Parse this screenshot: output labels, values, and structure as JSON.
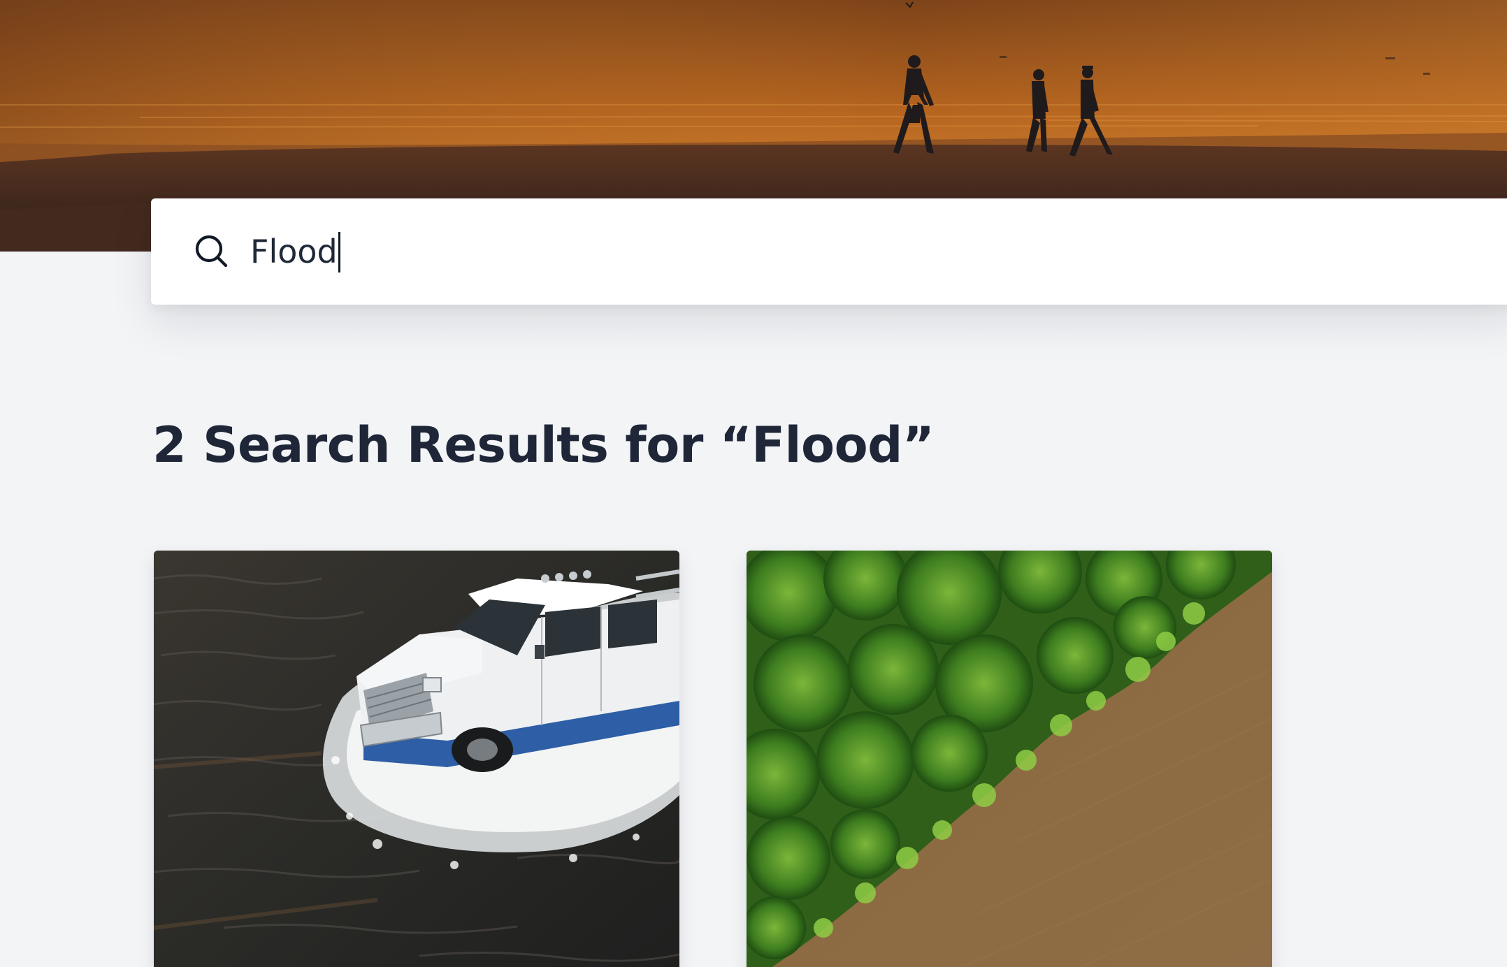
{
  "hero": {
    "image": "sunset-beach-silhouettes"
  },
  "search": {
    "value": "Flood",
    "icon": "search-icon"
  },
  "results": {
    "heading": "2 Search Results for “Flood”",
    "items": [
      {
        "image": "truck-driving-through-floodwater"
      },
      {
        "image": "aerial-river-and-trees"
      }
    ]
  }
}
